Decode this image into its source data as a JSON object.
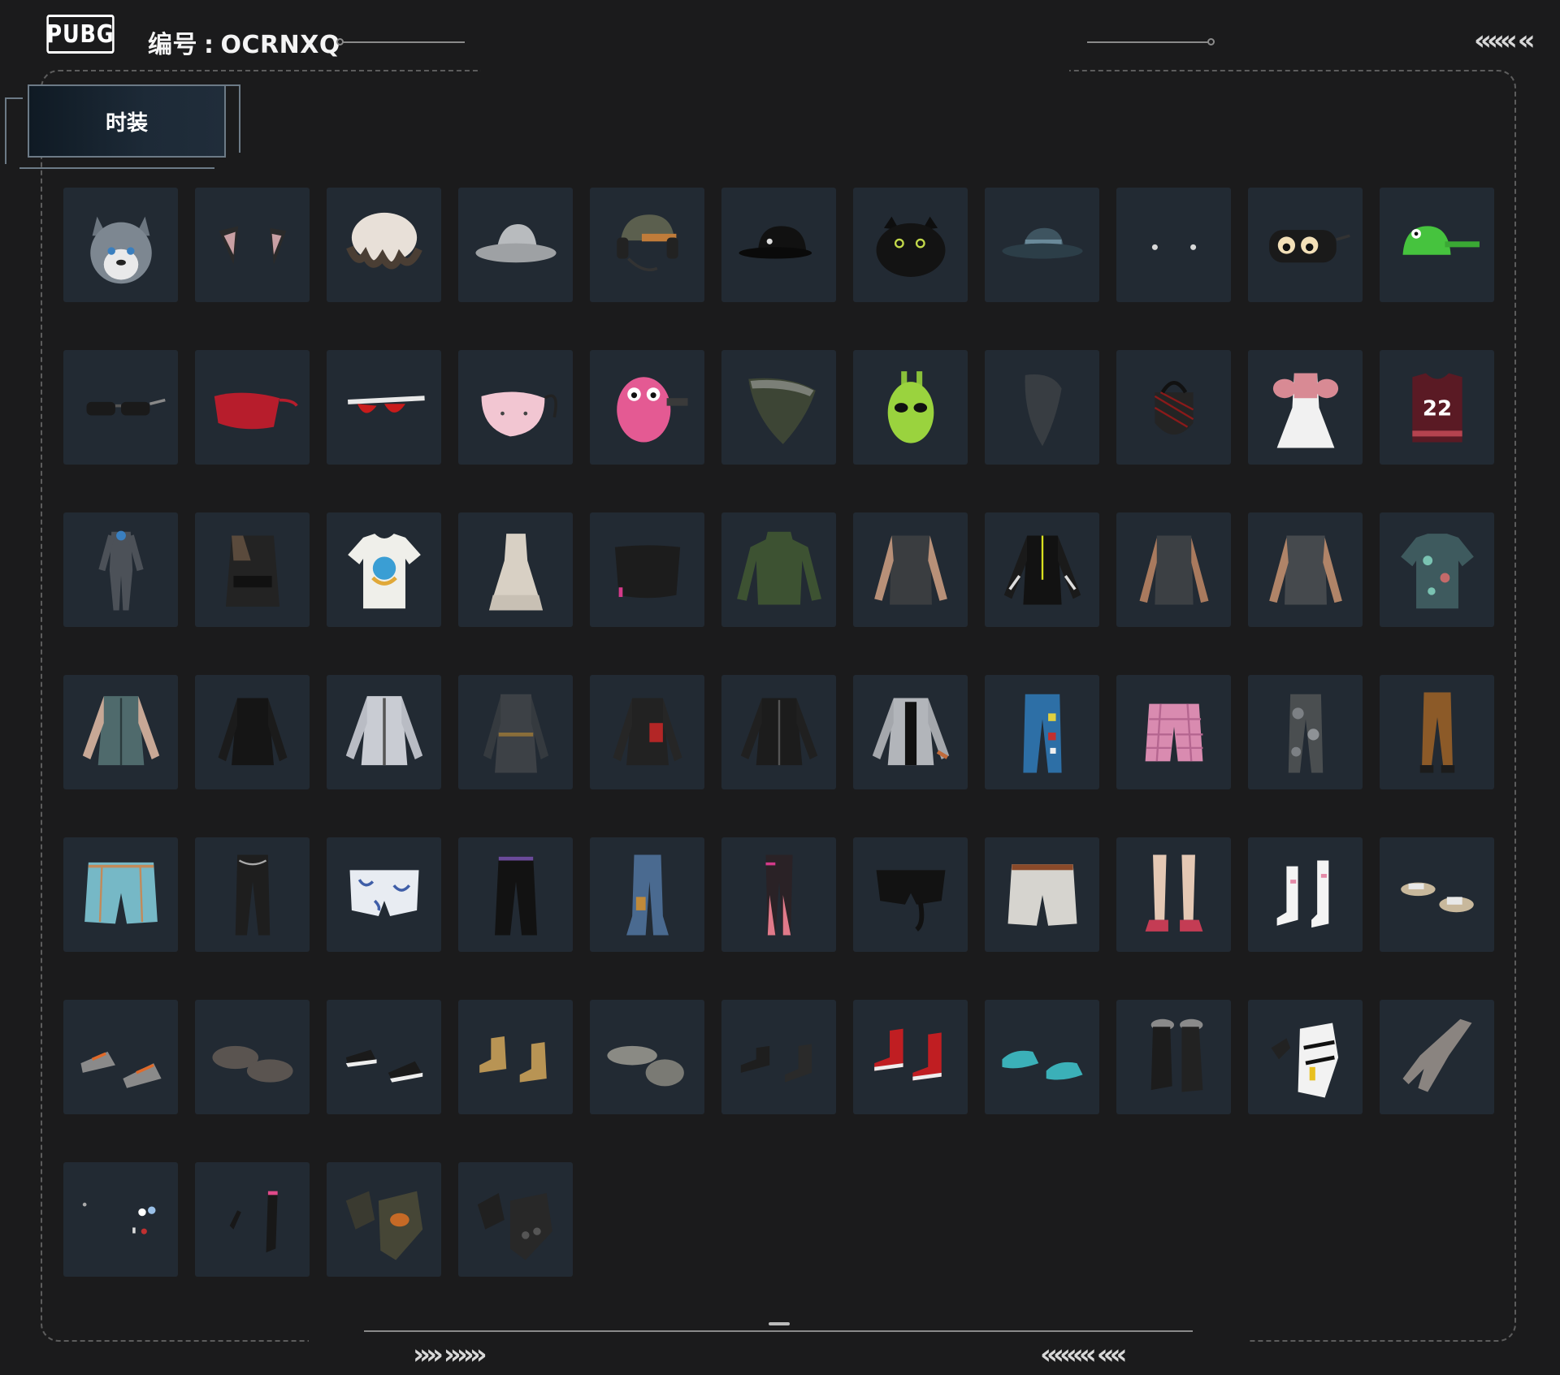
{
  "header": {
    "logo_text": "PUBG",
    "code_label": "编号",
    "code_value": "OCRNXQ"
  },
  "tabs": [
    {
      "label": "时装",
      "selected": true
    }
  ],
  "items": [
    {
      "name": "husky-head"
    },
    {
      "name": "cat-ears"
    },
    {
      "name": "ruffle-cap"
    },
    {
      "name": "bucket-hat-gray"
    },
    {
      "name": "headset-cap"
    },
    {
      "name": "black-cap"
    },
    {
      "name": "black-cat-hat"
    },
    {
      "name": "fishing-hat"
    },
    {
      "name": "stud-earrings"
    },
    {
      "name": "dog-eye-mask"
    },
    {
      "name": "frog-cap"
    },
    {
      "name": "sunglasses-black"
    },
    {
      "name": "red-eye-mask"
    },
    {
      "name": "red-sport-glasses"
    },
    {
      "name": "pink-face-mask"
    },
    {
      "name": "pink-dino-mask"
    },
    {
      "name": "bandana-mask"
    },
    {
      "name": "green-alien-mask"
    },
    {
      "name": "gray-face-scarf"
    },
    {
      "name": "tactical-mask"
    },
    {
      "name": "pink-ruffle-dress"
    },
    {
      "name": "jersey-22"
    },
    {
      "name": "gray-jumpsuit"
    },
    {
      "name": "tactical-vest"
    },
    {
      "name": "graphic-tee"
    },
    {
      "name": "white-dress"
    },
    {
      "name": "black-tube-top"
    },
    {
      "name": "green-turtleneck"
    },
    {
      "name": "tattoo-shirt"
    },
    {
      "name": "black-track-jacket"
    },
    {
      "name": "tattoo-tank"
    },
    {
      "name": "tattoo-tee"
    },
    {
      "name": "floral-shirt"
    },
    {
      "name": "floral-bomber"
    },
    {
      "name": "black-jacket"
    },
    {
      "name": "silver-jacket"
    },
    {
      "name": "gray-trench"
    },
    {
      "name": "leather-jacket-red"
    },
    {
      "name": "black-leather-jacket"
    },
    {
      "name": "silver-bomber"
    },
    {
      "name": "patched-jeans"
    },
    {
      "name": "pink-plaid-shorts"
    },
    {
      "name": "camo-pants"
    },
    {
      "name": "brown-pants"
    },
    {
      "name": "denim-shorts"
    },
    {
      "name": "black-cargo-pants"
    },
    {
      "name": "porcelain-shorts"
    },
    {
      "name": "black-wide-pants"
    },
    {
      "name": "flared-jeans"
    },
    {
      "name": "pink-leggings"
    },
    {
      "name": "black-leather-shorts"
    },
    {
      "name": "white-shorts"
    },
    {
      "name": "pink-stocking-heels"
    },
    {
      "name": "white-boots"
    },
    {
      "name": "slides"
    },
    {
      "name": "orange-sneakers"
    },
    {
      "name": "paw-slippers"
    },
    {
      "name": "black-sneakers"
    },
    {
      "name": "tan-boots"
    },
    {
      "name": "gray-loafers"
    },
    {
      "name": "black-boots"
    },
    {
      "name": "red-high-tops"
    },
    {
      "name": "teal-clogs"
    },
    {
      "name": "fur-boots"
    },
    {
      "name": "moto-gloves"
    },
    {
      "name": "bare-hand"
    },
    {
      "name": "small-accessories"
    },
    {
      "name": "arm-sleeves"
    },
    {
      "name": "tactical-gloves"
    },
    {
      "name": "black-gloves"
    }
  ],
  "colors": {
    "background": "#1b1b1c",
    "cell": "#222a33",
    "tab_gradient_start": "#0f1a24",
    "frame": "#5c5c5c"
  },
  "decor": {
    "chev_left": "«««",
    "chev_top_right": "«««  «",
    "chev_bottom_left": "»»  »»»",
    "chev_bottom_right": "««««  ««"
  }
}
